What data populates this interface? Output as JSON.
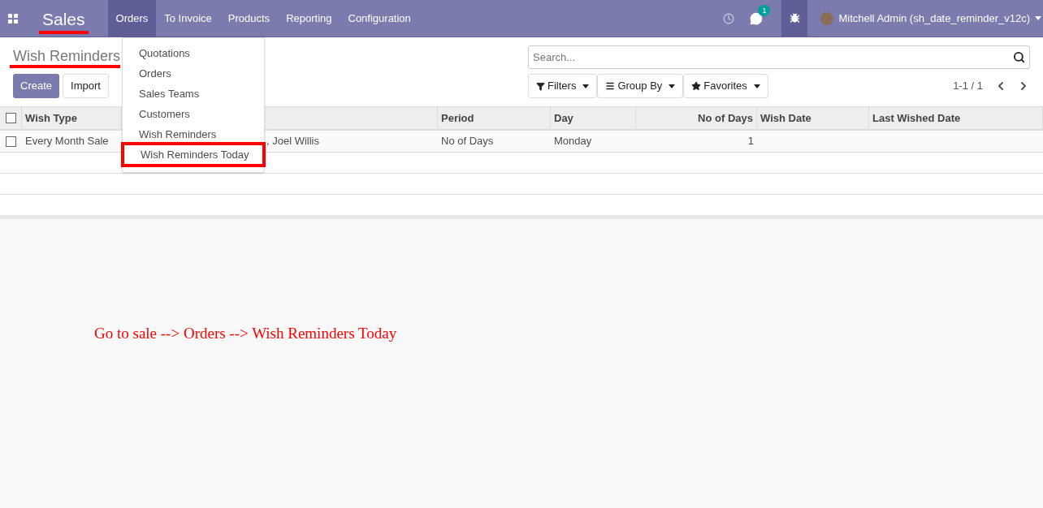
{
  "navbar": {
    "app_name": "Sales",
    "app_name_underlined": true,
    "menus": [
      {
        "label": "Orders",
        "selected": true
      },
      {
        "label": "To Invoice",
        "selected": false
      },
      {
        "label": "Products",
        "selected": false
      },
      {
        "label": "Reporting",
        "selected": false
      },
      {
        "label": "Configuration",
        "selected": false
      }
    ],
    "messages_badge": "1",
    "user": "Mitchell Admin (sh_date_reminder_v12c)"
  },
  "dropdown": {
    "items": [
      {
        "label": "Quotations",
        "annotated": false
      },
      {
        "label": "Orders",
        "annotated": false
      },
      {
        "label": "Sales Teams",
        "annotated": false
      },
      {
        "label": "Customers",
        "annotated": false
      },
      {
        "label": "Wish Reminders",
        "annotated": false
      },
      {
        "label": "Wish Reminders Today",
        "annotated": true
      }
    ]
  },
  "control_panel": {
    "title": "Wish Reminders",
    "title_underlined": true,
    "buttons": [
      "Create",
      "Import"
    ],
    "search": {
      "placeholder": "Search..."
    },
    "filters": [
      "Filters",
      "Group By",
      "Favorites"
    ],
    "pager": "1-1 / 1"
  },
  "table": {
    "columns": [
      "Wish Type",
      null,
      "Period",
      "Day",
      "No of Days",
      "Wish Date",
      "Last Wished Date"
    ],
    "rows": [
      {
        "checked": false,
        "cells": [
          "Every Month Sale",
          ", Joel Willis",
          "No of Days",
          "Monday",
          "1",
          "",
          ""
        ]
      }
    ],
    "header_checked": false
  },
  "annotation_text": "Go to sale --> Orders --> Wish Reminders Today"
}
